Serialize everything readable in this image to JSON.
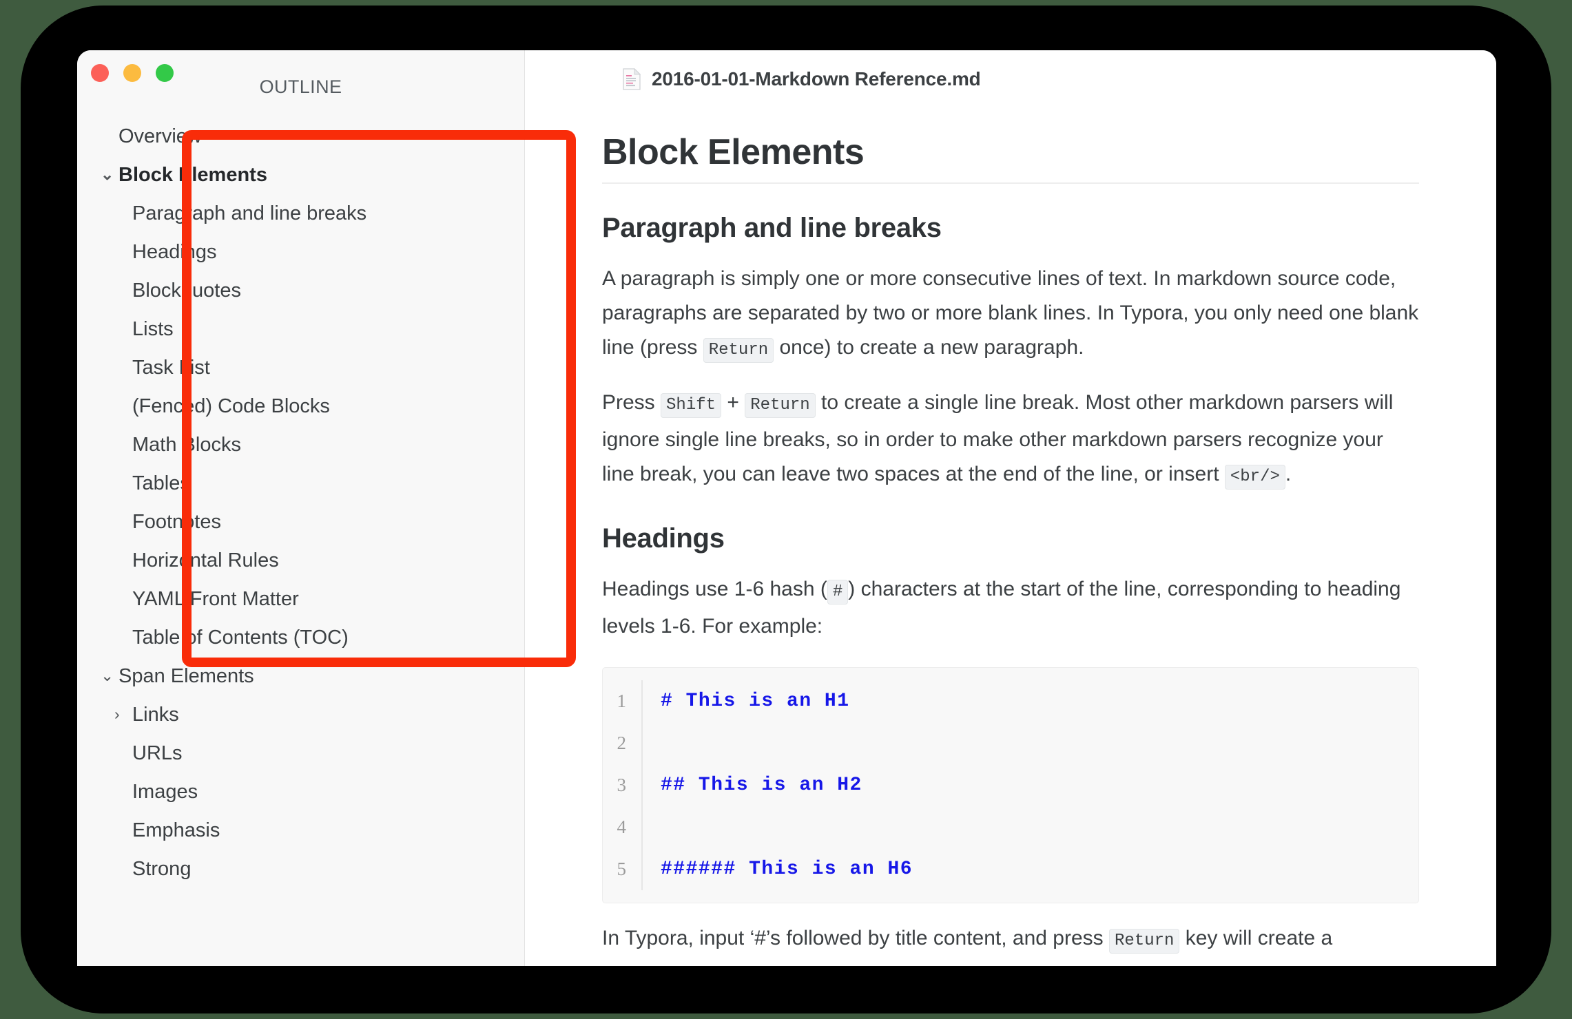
{
  "window": {
    "traffic_lights": [
      {
        "name": "close",
        "color": "#fc6058"
      },
      {
        "name": "minimize",
        "color": "#fcbb40"
      },
      {
        "name": "zoom",
        "color": "#33c948"
      }
    ]
  },
  "sidebar": {
    "header": "OUTLINE",
    "items": [
      {
        "label": "Overview",
        "level": 0,
        "bold": false,
        "chevron": "none"
      },
      {
        "label": "Block Elements",
        "level": 0,
        "bold": true,
        "chevron": "down"
      },
      {
        "label": "Paragraph and line breaks",
        "level": 1,
        "bold": false,
        "chevron": "none"
      },
      {
        "label": "Headings",
        "level": 1,
        "bold": false,
        "chevron": "none"
      },
      {
        "label": "Blockquotes",
        "level": 1,
        "bold": false,
        "chevron": "none"
      },
      {
        "label": "Lists",
        "level": 1,
        "bold": false,
        "chevron": "none"
      },
      {
        "label": "Task List",
        "level": 1,
        "bold": false,
        "chevron": "none"
      },
      {
        "label": "(Fenced) Code Blocks",
        "level": 1,
        "bold": false,
        "chevron": "none"
      },
      {
        "label": "Math Blocks",
        "level": 1,
        "bold": false,
        "chevron": "none"
      },
      {
        "label": "Tables",
        "level": 1,
        "bold": false,
        "chevron": "none"
      },
      {
        "label": "Footnotes",
        "level": 1,
        "bold": false,
        "chevron": "none"
      },
      {
        "label": "Horizontal Rules",
        "level": 1,
        "bold": false,
        "chevron": "none"
      },
      {
        "label": "YAML Front Matter",
        "level": 1,
        "bold": false,
        "chevron": "none"
      },
      {
        "label": "Table of Contents (TOC)",
        "level": 1,
        "bold": false,
        "chevron": "none"
      },
      {
        "label": "Span Elements",
        "level": 0,
        "bold": false,
        "chevron": "down"
      },
      {
        "label": "Links",
        "level": 1,
        "bold": false,
        "chevron": "right"
      },
      {
        "label": "URLs",
        "level": 1,
        "bold": false,
        "chevron": "none"
      },
      {
        "label": "Images",
        "level": 1,
        "bold": false,
        "chevron": "none"
      },
      {
        "label": "Emphasis",
        "level": 1,
        "bold": false,
        "chevron": "none"
      },
      {
        "label": "Strong",
        "level": 1,
        "bold": false,
        "chevron": "none"
      }
    ],
    "chevron_glyphs": {
      "down": "⌄",
      "right": "›"
    }
  },
  "document": {
    "title": "2016-01-01-Markdown Reference.md",
    "icon": "document-icon",
    "h1": "Block Elements",
    "sections": [
      {
        "heading": "Paragraph and line breaks",
        "paragraphs": [
          {
            "parts": [
              {
                "type": "text",
                "value": "A paragraph is simply one or more consecutive lines of text. In markdown source code, paragraphs are separated by two or more blank lines. In Typora, you only need one blank line (press "
              },
              {
                "type": "code",
                "value": "Return"
              },
              {
                "type": "text",
                "value": " once) to create a new paragraph."
              }
            ]
          },
          {
            "parts": [
              {
                "type": "text",
                "value": "Press "
              },
              {
                "type": "code",
                "value": "Shift"
              },
              {
                "type": "text",
                "value": " + "
              },
              {
                "type": "code",
                "value": "Return"
              },
              {
                "type": "text",
                "value": " to create a single line break. Most other markdown parsers will ignore single line breaks, so in order to make other markdown parsers recognize your line break, you can leave two spaces at the end of the line, or insert "
              },
              {
                "type": "code",
                "value": "<br/>"
              },
              {
                "type": "text",
                "value": "."
              }
            ]
          }
        ]
      },
      {
        "heading": "Headings",
        "paragraphs": [
          {
            "parts": [
              {
                "type": "text",
                "value": "Headings use 1-6 hash ("
              },
              {
                "type": "code",
                "value": "#"
              },
              {
                "type": "text",
                "value": ") characters at the start of the line, corresponding to heading levels 1-6. For example:"
              }
            ]
          }
        ],
        "code_block": {
          "lines": [
            {
              "number": "1",
              "text": "# This is an H1"
            },
            {
              "number": "2",
              "text": ""
            },
            {
              "number": "3",
              "text": "## This is an H2"
            },
            {
              "number": "4",
              "text": ""
            },
            {
              "number": "5",
              "text": "###### This is an H6"
            }
          ],
          "color": "#1617e8"
        },
        "trailing_paragraph": {
          "parts": [
            {
              "type": "text",
              "value": "In Typora, input ‘#’s followed by title content, and press "
            },
            {
              "type": "code",
              "value": "Return"
            },
            {
              "type": "text",
              "value": " key will create a"
            }
          ]
        }
      }
    ]
  },
  "annotation": {
    "name": "outline-panel-highlight",
    "color": "#f92c09"
  }
}
